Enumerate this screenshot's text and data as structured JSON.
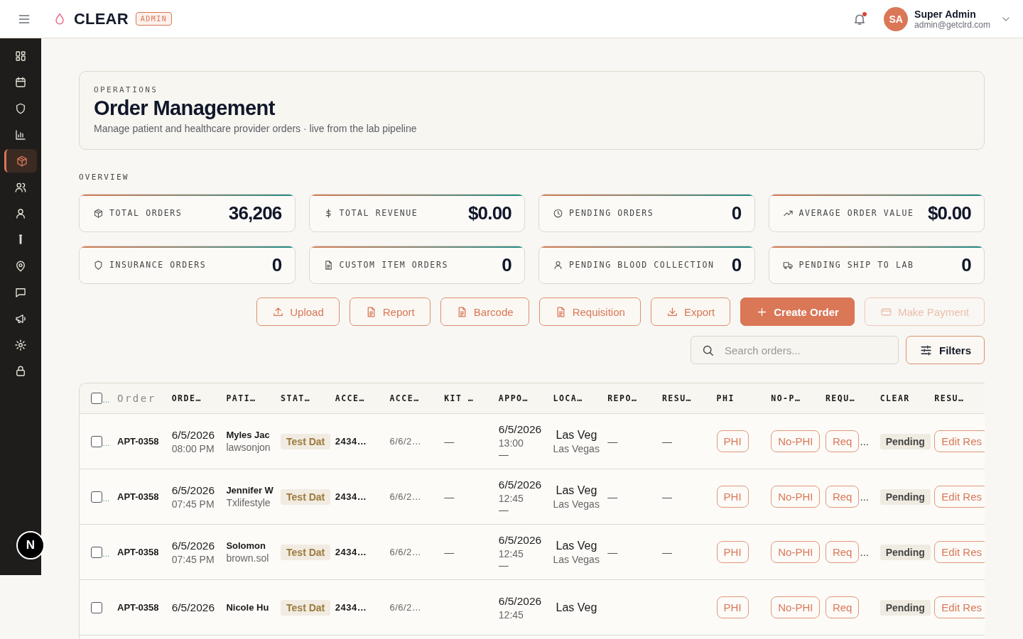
{
  "header": {
    "brand": "CLEAR",
    "badge": "ADMIN",
    "notification": {
      "unread": true
    },
    "user": {
      "initials": "SA",
      "name": "Super Admin",
      "email": "admin@getclrd.com"
    }
  },
  "sidebar": {
    "items": [
      {
        "selected": false
      },
      {
        "selected": false
      },
      {
        "selected": false
      },
      {
        "selected": false
      },
      {
        "selected": true
      },
      {
        "selected": false
      },
      {
        "selected": false
      },
      {
        "selected": false
      },
      {
        "selected": false
      },
      {
        "selected": false
      },
      {
        "selected": false
      },
      {
        "selected": false
      },
      {
        "selected": false
      }
    ],
    "dev_badge": "N"
  },
  "intro": {
    "eyebrow": "OPERATIONS",
    "title": "Order Management",
    "subtitle": "Manage patient and healthcare provider orders · live from the lab pipeline"
  },
  "overview": {
    "label": "OVERVIEW",
    "stats": [
      {
        "label": "TOTAL ORDERS",
        "value": "36,206"
      },
      {
        "label": "TOTAL REVENUE",
        "value": "$0.00"
      },
      {
        "label": "PENDING ORDERS",
        "value": "0"
      },
      {
        "label": "AVERAGE ORDER VALUE",
        "value": "$0.00"
      },
      {
        "label": "INSURANCE ORDERS",
        "value": "0"
      },
      {
        "label": "CUSTOM ITEM ORDERS",
        "value": "0"
      },
      {
        "label": "PENDING BLOOD COLLECTION",
        "value": "0"
      },
      {
        "label": "PENDING SHIP TO LAB",
        "value": "0"
      }
    ]
  },
  "actions": [
    {
      "label": "Upload",
      "kind": "outline",
      "disabled": false
    },
    {
      "label": "Report",
      "kind": "outline",
      "disabled": false
    },
    {
      "label": "Barcode",
      "kind": "outline",
      "disabled": false
    },
    {
      "label": "Requisition",
      "kind": "outline",
      "disabled": false
    },
    {
      "label": "Export",
      "kind": "outline",
      "disabled": false
    },
    {
      "label": "Create Order",
      "kind": "primary",
      "disabled": false
    },
    {
      "label": "Make Payment",
      "kind": "outline",
      "disabled": true
    }
  ],
  "search": {
    "placeholder": "Search orders..."
  },
  "filters": {
    "label": "Filters"
  },
  "table": {
    "select_all": {
      "checked": false,
      "suffix": "…"
    },
    "columns": [
      {
        "label": "Order",
        "kind": "muted"
      },
      {
        "label": "ORDE…",
        "kind": "heading"
      },
      {
        "label": "PATI…",
        "kind": "heading"
      },
      {
        "label": "STAT…",
        "kind": "heading"
      },
      {
        "label": "ACCE…",
        "kind": "heading"
      },
      {
        "label": "ACCE…",
        "kind": "heading"
      },
      {
        "label": "KIT …",
        "kind": "heading"
      },
      {
        "label": "APPO…",
        "kind": "heading"
      },
      {
        "label": "LOCA…",
        "kind": "heading"
      },
      {
        "label": "REPO…",
        "kind": "heading"
      },
      {
        "label": "RESU…",
        "kind": "heading"
      },
      {
        "label": "PHI",
        "kind": "heading"
      },
      {
        "label": "NO-P…",
        "kind": "heading"
      },
      {
        "label": "REQU…",
        "kind": "heading"
      },
      {
        "label": "CLEAR",
        "kind": "heading"
      },
      {
        "label": "RESU…",
        "kind": "heading"
      }
    ],
    "rows": [
      {
        "checked": false,
        "suffix": "…",
        "order_id": "APT-0358",
        "order_date": "6/5/2026",
        "order_time": "08:00 PM",
        "patient_name": "Myles Jac",
        "patient_email": "lawsonjon",
        "status": "Test Dat",
        "accession": "2434…",
        "accessioned": "6/6/2…",
        "kit": "—",
        "appointment_date": "6/5/2026",
        "appointment_time": "13:00",
        "appointment_note": "—",
        "location": "Las Veg",
        "location_sub": "Las Vegas",
        "report": "—",
        "result": "—",
        "phi": "PHI",
        "no_phi": "No-PHI",
        "requisition": "Req",
        "requisition_more": "...",
        "clear_status": "Pending",
        "result_action": "Edit Res"
      },
      {
        "checked": false,
        "suffix": "…",
        "order_id": "APT-0358",
        "order_date": "6/5/2026",
        "order_time": "07:45 PM",
        "patient_name": "Jennifer W",
        "patient_email": "Txlifestyle",
        "status": "Test Dat",
        "accession": "2434…",
        "accessioned": "6/6/2…",
        "kit": "—",
        "appointment_date": "6/5/2026",
        "appointment_time": "12:45",
        "appointment_note": "—",
        "location": "Las Veg",
        "location_sub": "Las Vegas",
        "report": "—",
        "result": "—",
        "phi": "PHI",
        "no_phi": "No-PHI",
        "requisition": "Req",
        "requisition_more": "...",
        "clear_status": "Pending",
        "result_action": "Edit Res"
      },
      {
        "checked": false,
        "suffix": "…",
        "order_id": "APT-0358",
        "order_date": "6/5/2026",
        "order_time": "07:45 PM",
        "patient_name": "Solomon",
        "patient_email": "brown.sol",
        "status": "Test Dat",
        "accession": "2434…",
        "accessioned": "6/6/2…",
        "kit": "—",
        "appointment_date": "6/5/2026",
        "appointment_time": "12:45",
        "appointment_note": "—",
        "location": "Las Veg",
        "location_sub": "Las Vegas",
        "report": "—",
        "result": "—",
        "phi": "PHI",
        "no_phi": "No-PHI",
        "requisition": "Req",
        "requisition_more": "...",
        "clear_status": "Pending",
        "result_action": "Edit Res"
      },
      {
        "checked": false,
        "order_id": "APT-0358",
        "order_date": "6/5/2026",
        "patient_name": "Nicole Hu",
        "status": "Test Dat",
        "accession": "2434…",
        "accessioned": "6/6/2…",
        "appointment_date": "6/5/2026",
        "appointment_time": "12:45",
        "location": "Las Veg",
        "phi": "PHI",
        "no_phi": "No-PHI",
        "requisition": "Req",
        "clear_status": "Pending",
        "result_action": "Edit Res"
      }
    ]
  }
}
